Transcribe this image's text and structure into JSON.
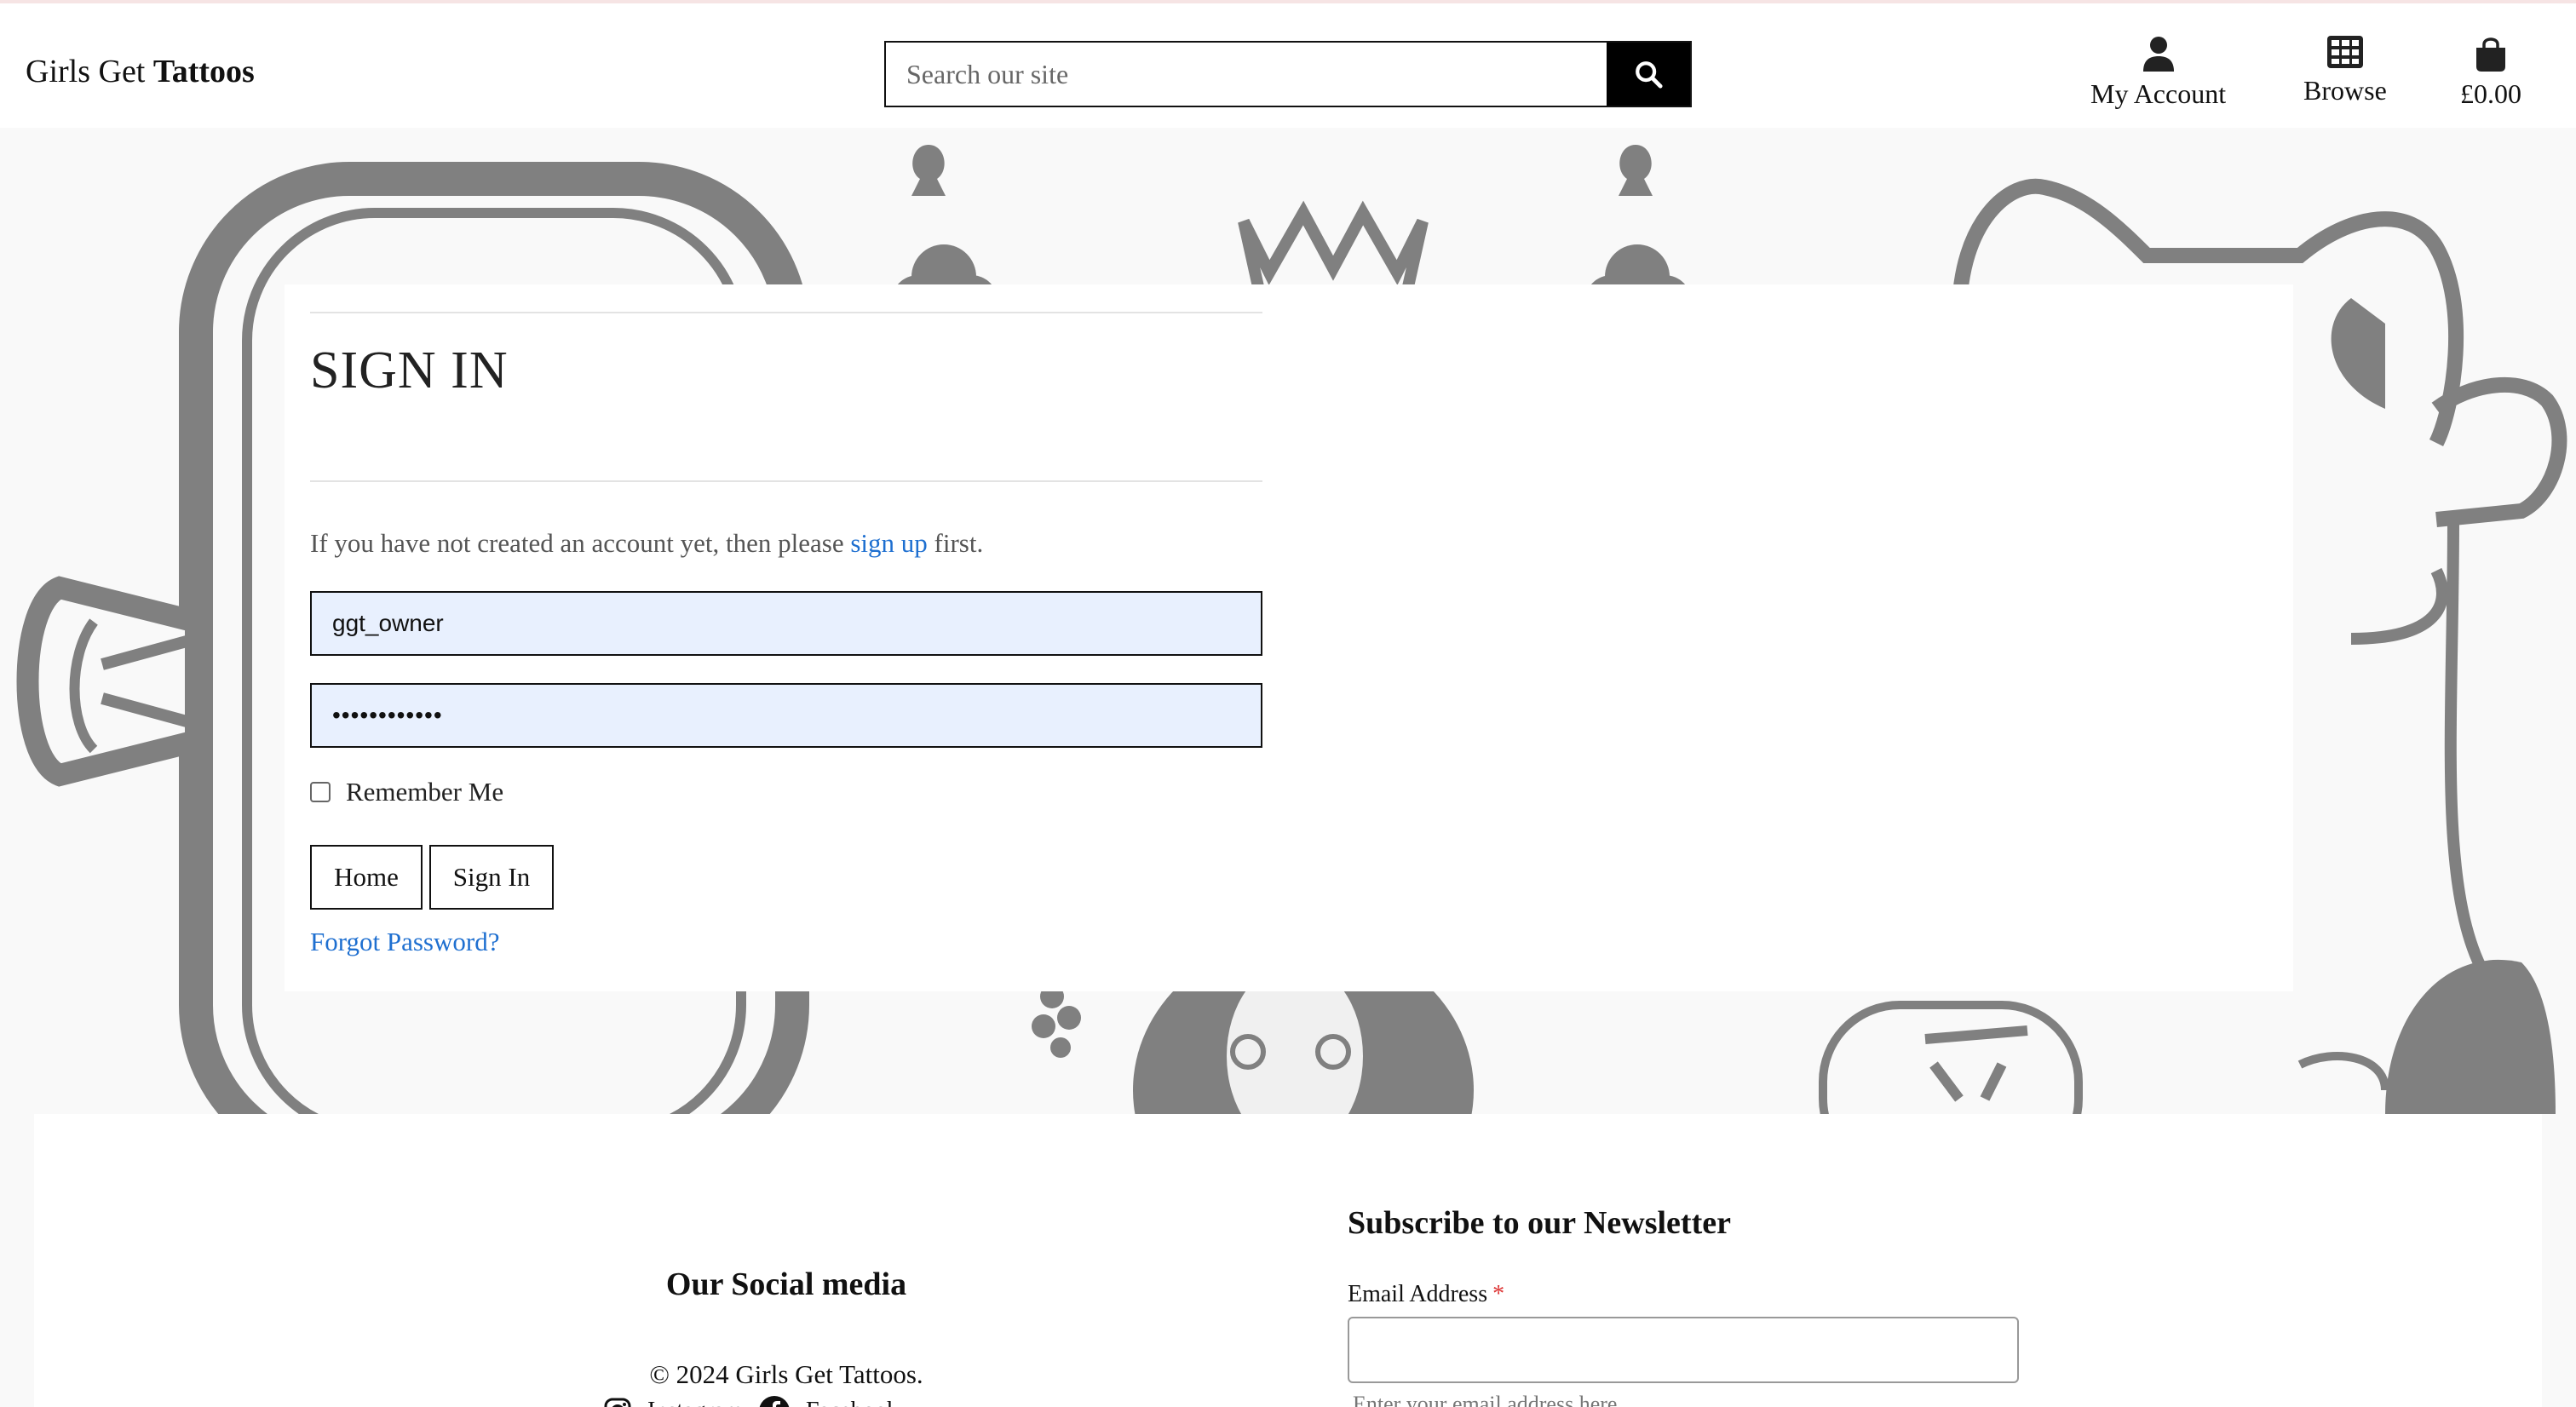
{
  "header": {
    "brand_regular": "Girls Get",
    "brand_bold": "Tattoos",
    "search_placeholder": "Search our site",
    "nav": {
      "account": "My Account",
      "browse": "Browse",
      "bag": "£0.00"
    }
  },
  "signin": {
    "title": "SIGN IN",
    "intro_before": "If you have not created an account yet, then please ",
    "intro_link": "sign up",
    "intro_after": " first.",
    "username_value": "ggt_owner",
    "password_masked": "••••••••••••",
    "remember_label": "Remember Me",
    "home_button": "Home",
    "signin_button": "Sign In",
    "forgot_link": "Forgot Password?"
  },
  "footer": {
    "social_title": "Our Social media",
    "copyright": "© 2024 Girls Get Tattoos.",
    "social_links": [
      {
        "label": "Instagram",
        "icon": "instagram-icon"
      },
      {
        "label": "Facebook",
        "icon": "facebook-icon"
      }
    ],
    "newsletter_title": "Subscribe to our Newsletter",
    "email_label": "Email Address",
    "email_required_mark": "*",
    "email_help": "Enter your email address here"
  },
  "colors": {
    "link": "#1e6fd0",
    "input_fill": "#e8f0fe",
    "illustration": "#808080",
    "required": "#dd3333"
  }
}
